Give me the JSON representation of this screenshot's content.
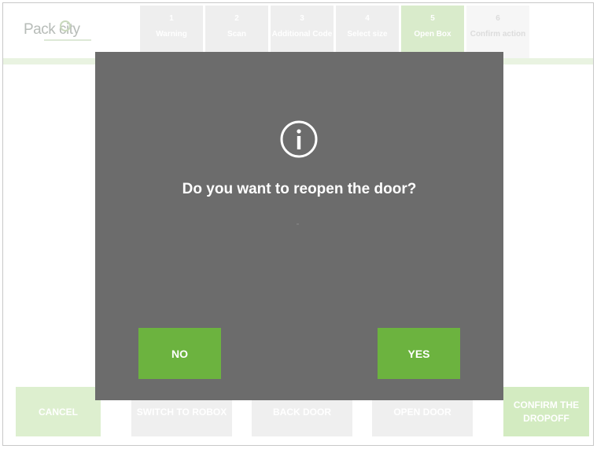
{
  "header": {
    "logo_text": "Pack city",
    "steps": [
      {
        "num": "1",
        "label": "Warning",
        "state": "done"
      },
      {
        "num": "2",
        "label": "Scan",
        "state": "done"
      },
      {
        "num": "3",
        "label": "Additional Code",
        "state": "done"
      },
      {
        "num": "4",
        "label": "Select size",
        "state": "done"
      },
      {
        "num": "5",
        "label": "Open Box",
        "state": "active"
      },
      {
        "num": "6",
        "label": "Confirm action",
        "state": "future"
      }
    ]
  },
  "footer": {
    "cancel_label": "CANCEL",
    "btn2_label": "SWITCH TO ROBOX",
    "btn3_label": "BACK DOOR",
    "btn4_label": "OPEN DOOR",
    "confirm_label": "CONFIRM THE DROPOFF"
  },
  "dialog": {
    "icon": "info-icon",
    "question": "Do you want to reopen the door?",
    "no_label": "NO",
    "yes_label": "YES"
  },
  "colors": {
    "brand_green": "#6cb33f",
    "modal_bg": "#6c6c6c"
  }
}
